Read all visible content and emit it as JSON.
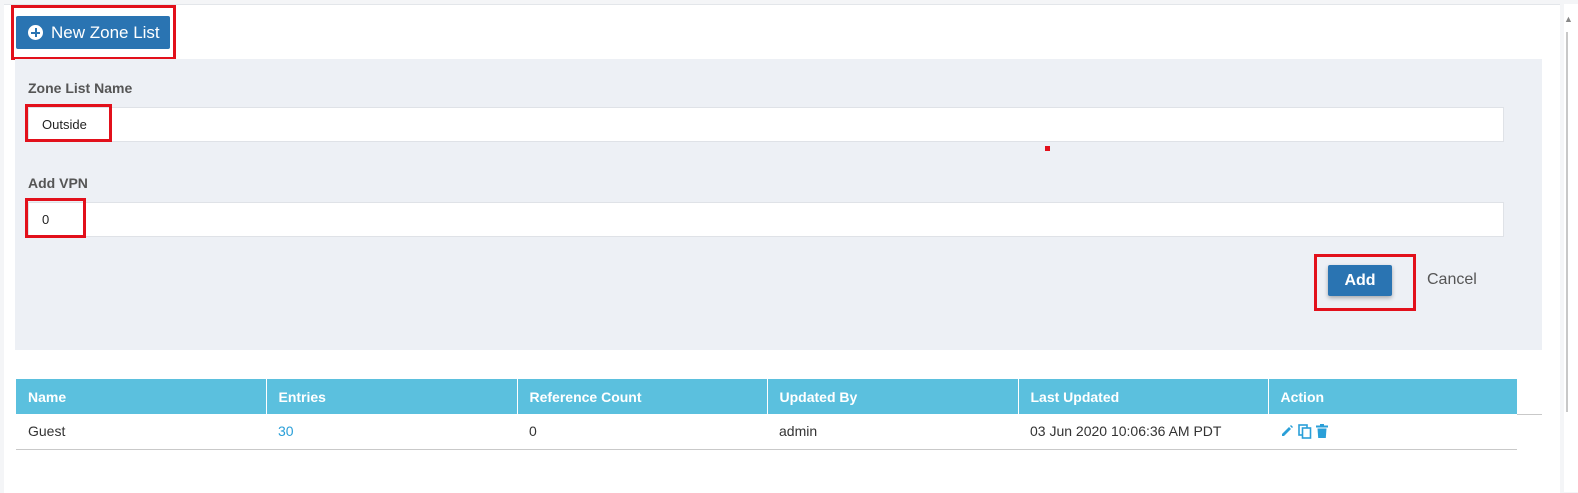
{
  "toolbar": {
    "new_zone_list_label": "New Zone List"
  },
  "form": {
    "zone_list_name_label": "Zone List Name",
    "zone_list_name_value": "Outside",
    "add_vpn_label": "Add VPN",
    "add_vpn_value": "0",
    "add_label": "Add",
    "cancel_label": "Cancel"
  },
  "table": {
    "headers": [
      "Name",
      "Entries",
      "Reference Count",
      "Updated By",
      "Last Updated",
      "Action"
    ],
    "rows": [
      {
        "name": "Guest",
        "entries": "30",
        "reference_count": "0",
        "updated_by": "admin",
        "last_updated": "03 Jun 2020 10:06:36 AM PDT",
        "actions": [
          "edit-icon",
          "copy-icon",
          "delete-icon"
        ]
      }
    ]
  },
  "colors": {
    "primary_button": "#2a74b2",
    "table_header": "#5bc0de",
    "link": "#2a9fd8",
    "highlight": "#e2101b",
    "form_background": "#edf0f5"
  }
}
